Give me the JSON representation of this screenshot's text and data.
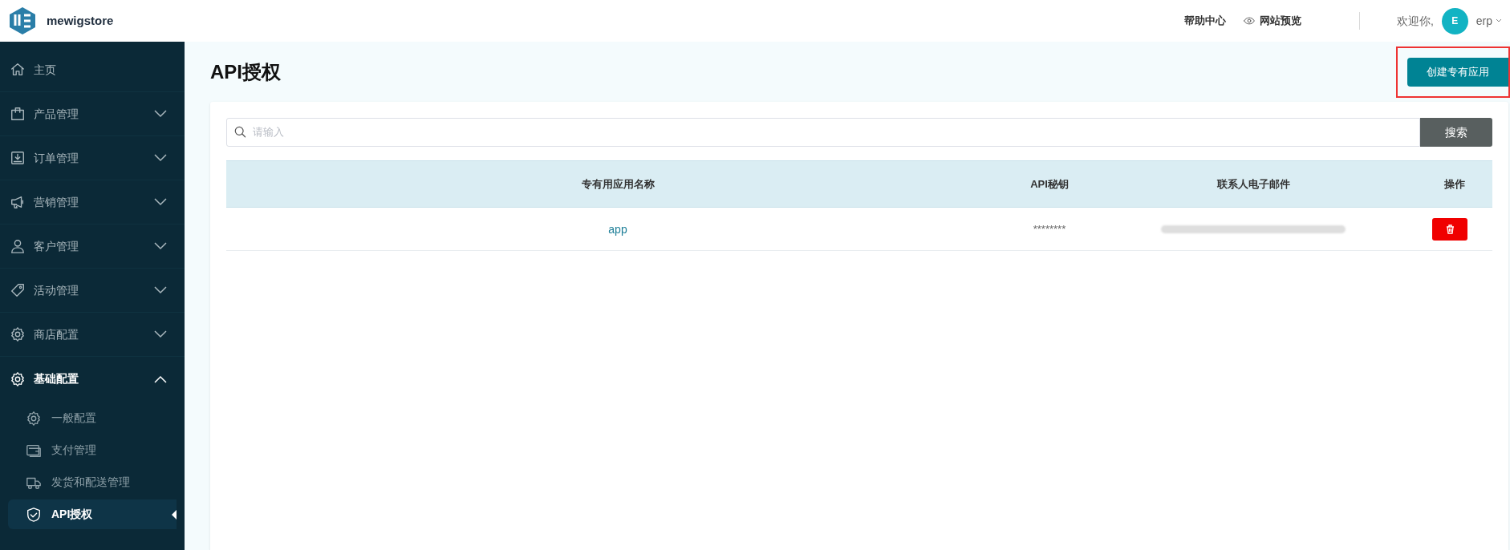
{
  "header": {
    "brand": "mewigstore",
    "links": [
      "帮助中心",
      "网站预览"
    ],
    "greeting": "欢迎你,",
    "avatar": "E",
    "user": "erp"
  },
  "sidebar": {
    "items": [
      {
        "label": "主页"
      },
      {
        "label": "产品管理",
        "expanded": false
      },
      {
        "label": "订单管理",
        "expanded": false
      },
      {
        "label": "营销管理",
        "expanded": false
      },
      {
        "label": "客户管理",
        "expanded": false
      },
      {
        "label": "活动管理",
        "expanded": false
      },
      {
        "label": "商店配置",
        "expanded": false
      },
      {
        "label": "基础配置",
        "expanded": true,
        "children": [
          {
            "label": "一般配置",
            "selected": false
          },
          {
            "label": "支付管理",
            "selected": false
          },
          {
            "label": "发货和配送管理",
            "selected": false
          },
          {
            "label": "API授权",
            "selected": true
          }
        ]
      }
    ]
  },
  "page": {
    "title": "API授权",
    "create_button": "创建专有应用",
    "search": {
      "placeholder": "请输入",
      "button": "搜索"
    },
    "table": {
      "columns": [
        "专有用应用名称",
        "API秘钥",
        "联系人电子邮件",
        "操作"
      ],
      "rows": [
        {
          "name": "app",
          "key": "********"
        }
      ]
    }
  }
}
